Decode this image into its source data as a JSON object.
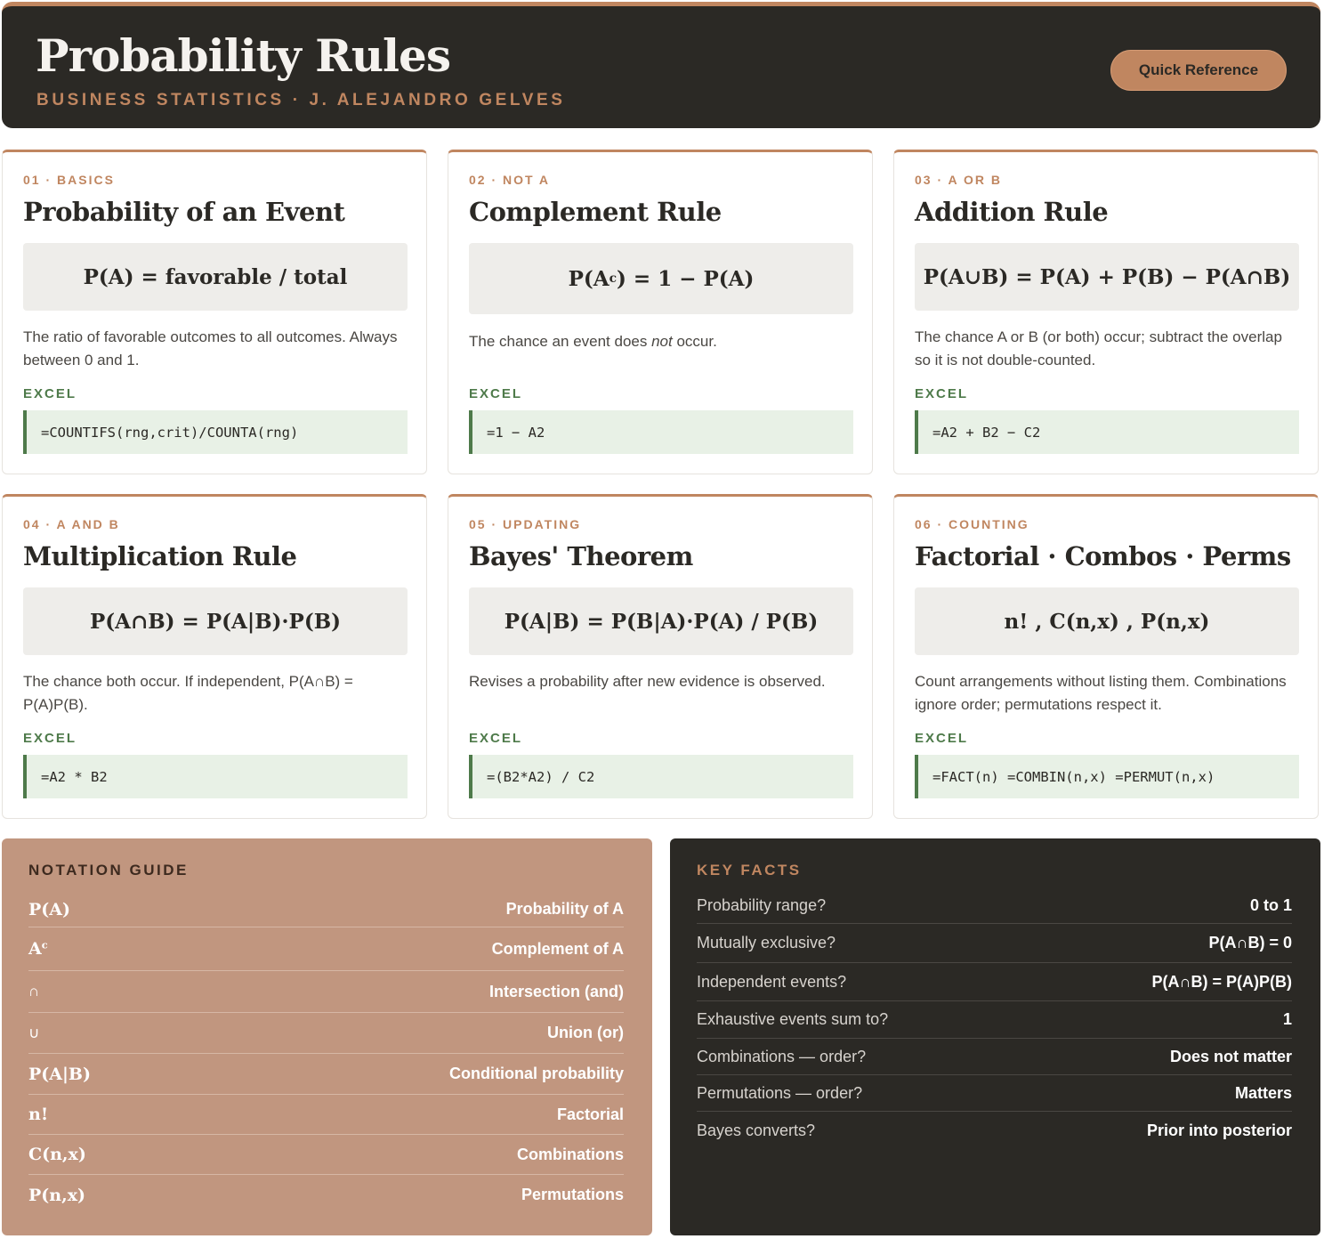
{
  "header": {
    "title": "Probability Rules",
    "subtitle": "BUSINESS STATISTICS · J. ALEJANDRO GELVES",
    "button_label": "Quick Reference"
  },
  "colors": {
    "accent": "#c08660",
    "dark": "#2b2925",
    "excel_green": "#4e7a4a",
    "notation_bg": "#c1967f"
  },
  "cards": [
    {
      "tag": "01 · BASICS",
      "title": "Probability of an Event",
      "formula": "P(A) = favorable / total",
      "description": "The ratio of favorable outcomes to all outcomes. Always between 0 and 1.",
      "excel_label": "EXCEL",
      "excel": "=COUNTIFS(rng,crit)/COUNTA(rng)"
    },
    {
      "tag": "02 · NOT A",
      "title": "Complement Rule",
      "formula_pre": "P(A",
      "formula_sup": "c",
      "formula_post": ") = 1 − P(A)",
      "description_pre": "The chance an event does ",
      "description_em": "not",
      "description_post": " occur.",
      "excel_label": "EXCEL",
      "excel": "=1 − A2"
    },
    {
      "tag": "03 · A OR B",
      "title": "Addition Rule",
      "formula": "P(A∪B) = P(A) + P(B) − P(A∩B)",
      "description": "The chance A or B (or both) occur; subtract the overlap so it is not double-counted.",
      "excel_label": "EXCEL",
      "excel": "=A2 + B2 − C2"
    },
    {
      "tag": "04 · A AND B",
      "title": "Multiplication Rule",
      "formula": "P(A∩B) = P(A|B)·P(B)",
      "description": "The chance both occur. If independent, P(A∩B) = P(A)P(B).",
      "excel_label": "EXCEL",
      "excel": "=A2 * B2"
    },
    {
      "tag": "05 · UPDATING",
      "title": "Bayes' Theorem",
      "formula": "P(A|B) = P(B|A)·P(A) / P(B)",
      "description": "Revises a probability after new evidence is observed.",
      "excel_label": "EXCEL",
      "excel": "=(B2*A2) / C2"
    },
    {
      "tag": "06 · COUNTING",
      "title": "Factorial · Combos · Perms",
      "formula": "n! , C(n,x) , P(n,x)",
      "description": "Count arrangements without listing them. Combinations ignore order; permutations respect it.",
      "excel_label": "EXCEL",
      "excel": "=FACT(n) =COMBIN(n,x) =PERMUT(n,x)"
    }
  ],
  "notation": {
    "title": "NOTATION GUIDE",
    "rows": [
      {
        "symbol": "P(A)",
        "meaning": "Probability of A"
      },
      {
        "symbol": "A",
        "symbol_sup": "c",
        "meaning": "Complement of A"
      },
      {
        "symbol": "∩",
        "meaning": "Intersection (and)"
      },
      {
        "symbol": "∪",
        "meaning": "Union (or)"
      },
      {
        "symbol": "P(A|B)",
        "meaning": "Conditional probability"
      },
      {
        "symbol": "n!",
        "meaning": "Factorial"
      },
      {
        "symbol": "C(n,x)",
        "meaning": "Combinations"
      },
      {
        "symbol": "P(n,x)",
        "meaning": "Permutations"
      }
    ]
  },
  "facts": {
    "title": "KEY FACTS",
    "rows": [
      {
        "q": "Probability range?",
        "a": "0 to 1"
      },
      {
        "q": "Mutually exclusive?",
        "a": "P(A∩B) = 0"
      },
      {
        "q": "Independent events?",
        "a": "P(A∩B) = P(A)P(B)"
      },
      {
        "q": "Exhaustive events sum to?",
        "a": "1"
      },
      {
        "q": "Combinations — order?",
        "a": "Does not matter"
      },
      {
        "q": "Permutations — order?",
        "a": "Matters"
      },
      {
        "q": "Bayes converts?",
        "a": "Prior into posterior"
      }
    ]
  }
}
